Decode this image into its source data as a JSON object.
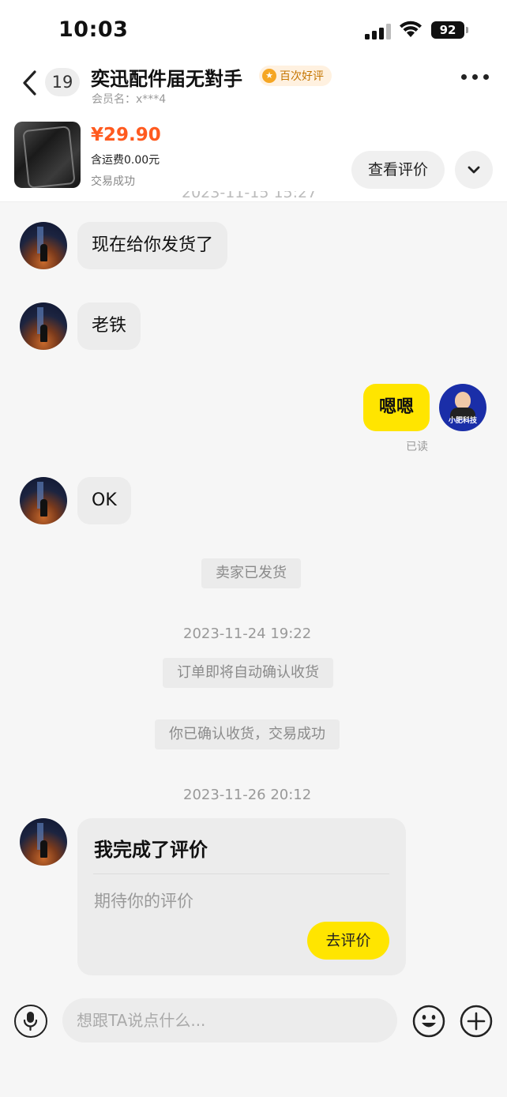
{
  "status_bar": {
    "time": "10:03",
    "battery": "92"
  },
  "header": {
    "unread_count": "19",
    "shop_name": "奕迅配件届无對手",
    "badge_text": "百次好评",
    "member_label": "会员名：x***4"
  },
  "product": {
    "price": "¥29.90",
    "shipping": "含运费0.00元",
    "status": "交易成功",
    "review_button": "查看评价"
  },
  "clipped_timestamp": "2023-11-15 15:27",
  "messages": {
    "m1": "现在给你发货了",
    "m2": "老铁",
    "m3": "嗯嗯",
    "m3_read": "已读",
    "m4": "OK"
  },
  "my_avatar_text": "小肥科技",
  "system": {
    "shipped": "卖家已发货",
    "ts1": "2023-11-24 19:22",
    "auto_confirm": "订单即将自动确认收货",
    "confirmed": "你已确认收货，交易成功",
    "ts2": "2023-11-26 20:12"
  },
  "review_card": {
    "title": "我完成了评价",
    "subtitle": "期待你的评价",
    "button": "去评价"
  },
  "input": {
    "placeholder": "想跟TA说点什么..."
  },
  "icons": {
    "back": "chevron-left-icon",
    "more": "more-dots-icon",
    "expand": "chevron-down-icon",
    "mic": "microphone-icon",
    "emoji": "emoji-icon",
    "plus": "plus-icon"
  },
  "colors": {
    "accent_yellow": "#ffe500",
    "price_orange": "#ff5a1f"
  }
}
